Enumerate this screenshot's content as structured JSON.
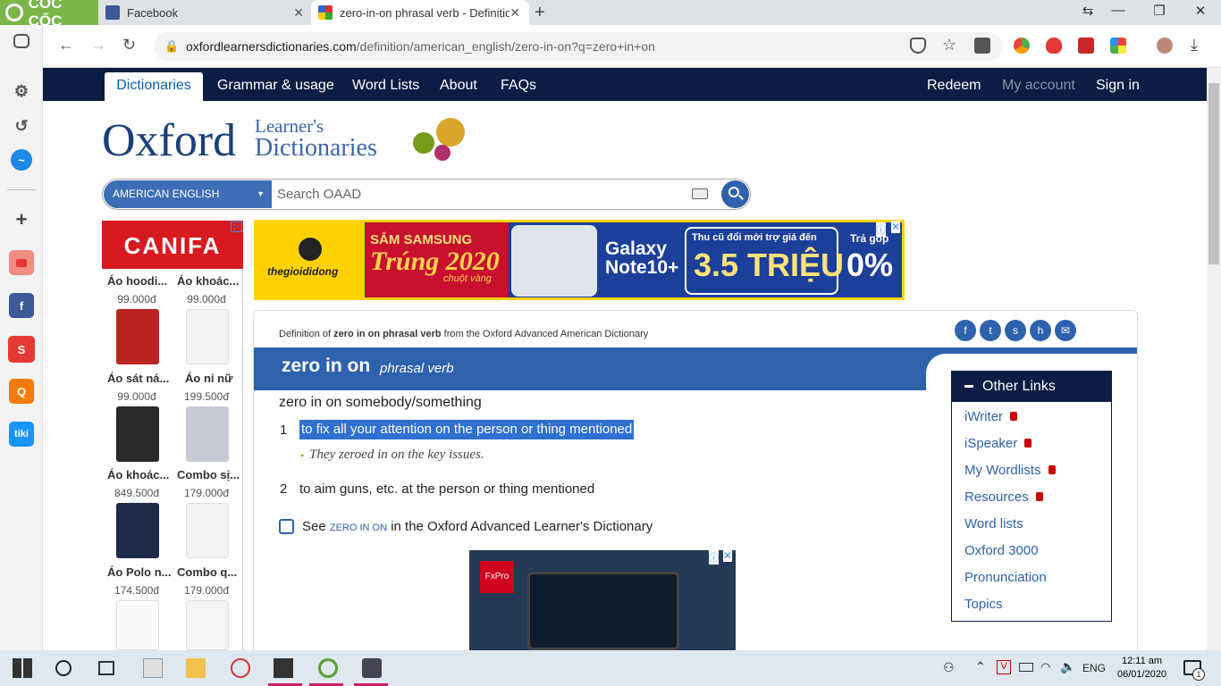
{
  "browser": {
    "brand": "CỐC CỐC",
    "tabs": [
      {
        "title": "Facebook",
        "icon": "facebook-icon",
        "active": false
      },
      {
        "title": "zero-in-on phrasal verb - Definitio",
        "icon": "oxford-favicon",
        "active": true
      }
    ],
    "url_host": "oxfordlearnersdictionaries.com",
    "url_path": "/definition/american_english/zero-in-on?q=zero+in+on"
  },
  "site_nav": {
    "left": [
      "Dictionaries",
      "Grammar & usage",
      "Word Lists",
      "About",
      "FAQs"
    ],
    "right": [
      "Redeem",
      "My account",
      "Sign in"
    ]
  },
  "logo": {
    "main": "Oxford",
    "sub1": "Learner's",
    "sub2": "Dictionaries"
  },
  "search": {
    "language": "AMERICAN ENGLISH",
    "placeholder": "Search OAAD"
  },
  "left_ad": {
    "brand": "CANIFA",
    "products": [
      {
        "name": "Áo hoodi...",
        "price": "99.000đ"
      },
      {
        "name": "Áo khoác...",
        "price": "99.000đ"
      },
      {
        "name": "Áo sát ná...",
        "price": "99.000đ"
      },
      {
        "name": "Áo nỉ nữ",
        "price": "199.500đ"
      },
      {
        "name": "Áo khoác...",
        "price": "849.500đ"
      },
      {
        "name": "Combo sị...",
        "price": "179.000đ"
      },
      {
        "name": "Áo Polo n...",
        "price": "174.500đ"
      },
      {
        "name": "Combo q...",
        "price": "179.000đ"
      }
    ]
  },
  "banner": {
    "store": "thegioididong",
    "headline1": "SẮM SAMSUNG",
    "headline2": "Trúng 2020",
    "headline3": "chuột vàng",
    "product": "Galaxy Note10+",
    "offer_label": "Thu cũ đổi mới trợ giá đến",
    "offer_value": "3.5 TRIỆU",
    "installment_label": "Trả góp",
    "installment_value": "0%"
  },
  "entry": {
    "source_prefix": "Definition of ",
    "source_term": "zero in on phrasal verb",
    "source_suffix": " from the Oxford Advanced American Dictionary",
    "headword": "zero in on",
    "pos": "phrasal verb",
    "idiom": "zero in on somebody/something",
    "senses": [
      {
        "num": "1",
        "def": "to fix all your attention on the person or thing mentioned",
        "example": "They zeroed in on the key issues."
      },
      {
        "num": "2",
        "def": "to aim guns, etc. at the person or thing mentioned"
      }
    ],
    "see_prefix": "See ",
    "see_term": "ZERO IN ON",
    "see_suffix": " in the Oxford Advanced Learner's Dictionary"
  },
  "other_links": {
    "title": "Other Links",
    "items": [
      {
        "label": "iWriter",
        "locked": true
      },
      {
        "label": "iSpeaker",
        "locked": true
      },
      {
        "label": "My Wordlists",
        "locked": true
      },
      {
        "label": "Resources",
        "locked": true
      },
      {
        "label": "Word lists",
        "locked": false
      },
      {
        "label": "Oxford 3000",
        "locked": false
      },
      {
        "label": "Pronunciation",
        "locked": false
      },
      {
        "label": "Topics",
        "locked": false
      }
    ]
  },
  "bottom_ad": {
    "brand": "FxPro"
  },
  "taskbar": {
    "lang": "ENG",
    "time": "12:11 am",
    "date": "06/01/2020",
    "notifications": "1"
  },
  "colors": {
    "navy": "#0b1d43",
    "blue": "#2f62ad",
    "highlight": "#3070d0",
    "canifa": "#d71920",
    "banner_yellow": "#ffd200"
  }
}
